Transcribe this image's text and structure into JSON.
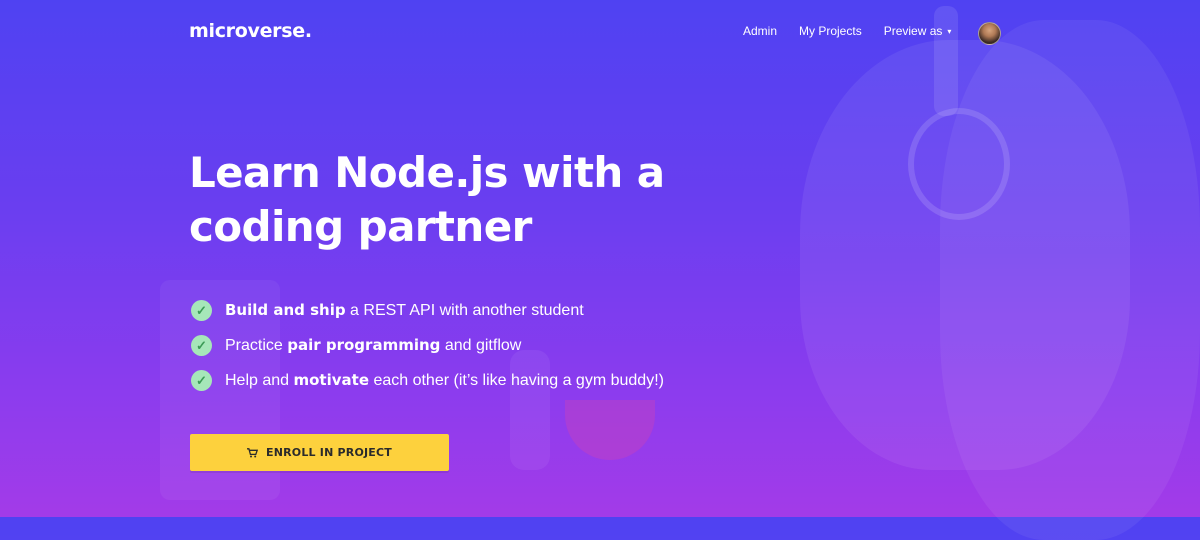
{
  "brand": {
    "logo": "microverse."
  },
  "nav": {
    "links": [
      "Admin",
      "My Projects"
    ],
    "dropdown_label": "Preview as",
    "caret": "▾"
  },
  "hero": {
    "title": "Learn Node.js with a coding partner",
    "features": [
      {
        "bold": "Build and ship",
        "after": " a REST API with another student"
      },
      {
        "before": "Practice ",
        "bold": "pair programming",
        "after": " and gitflow"
      },
      {
        "before": "Help and ",
        "bold": "motivate",
        "after": " each other (it’s like having a gym buddy!)"
      }
    ],
    "cta_label": "ENROLL IN PROJECT"
  },
  "icons": {
    "check": "check-icon",
    "cart": "cart-icon"
  },
  "colors": {
    "gradient_top": "#4f42f2",
    "gradient_bottom": "#a33be8",
    "cta_background": "#fdd13d",
    "check_background": "#a6e7b9"
  }
}
